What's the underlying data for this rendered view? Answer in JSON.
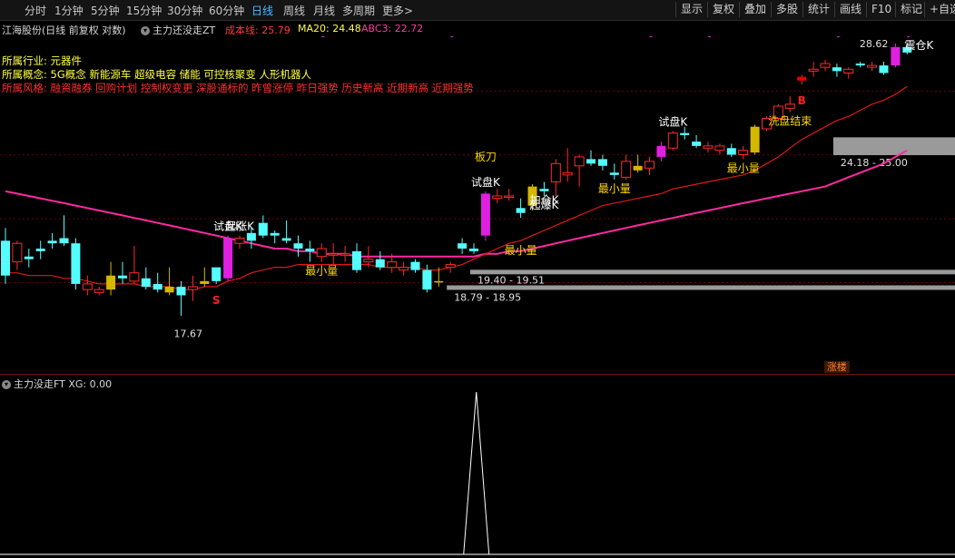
{
  "toolbar": {
    "periods": [
      "分时",
      "1分钟",
      "5分钟",
      "15分钟",
      "30分钟",
      "60分钟",
      "日线",
      "周线",
      "月线",
      "多周期",
      "更多>"
    ],
    "active_period": "日线",
    "buttons": [
      "显示",
      "复权",
      "叠加",
      "多股",
      "统计",
      "画线",
      "F10",
      "标记",
      "+自选"
    ]
  },
  "header": {
    "stock": "江海股份(日线 前复权 对数)",
    "indicator": "主力还没走ZT",
    "cost_line": "成本线: 25.79",
    "ma20": "MA20: 24.48",
    "abc3": "ABC3: 22.72"
  },
  "info": {
    "industry_label": "所属行业:",
    "industry": "元器件",
    "concept_label": "所属概念:",
    "concepts": "5G概念 新能源车 超级电容 储能 可控核聚变 人形机器人",
    "style_label": "所属风格:",
    "styles": "融资融券 回购计划 控制权变更 深股通标的 昨曾涨停 昨日强势 历史新高 近期新高 近期强势"
  },
  "sub_panel": {
    "title": "主力没走FT XG: 0.00"
  },
  "colors": {
    "up": "#ff2a2a",
    "down": "#54ffff",
    "magenta_bar": "#e020e0",
    "gold_bar": "#d4b800",
    "ma_pink": "#ff2aa0",
    "cost_red": "#e01818",
    "grid": "#6a0000"
  },
  "chart_data": {
    "type": "candlestick",
    "scale": "log",
    "price_min": 16.5,
    "price_max": 30.0,
    "candles": [
      {
        "o": 20.6,
        "h": 21.1,
        "l": 19.0,
        "c": 19.3,
        "s": "d"
      },
      {
        "o": 19.8,
        "h": 20.6,
        "l": 19.5,
        "c": 20.5,
        "s": "u"
      },
      {
        "o": 19.9,
        "h": 20.3,
        "l": 19.6,
        "c": 20.0,
        "s": "d"
      },
      {
        "o": 20.2,
        "h": 20.6,
        "l": 19.9,
        "c": 20.3,
        "s": "d"
      },
      {
        "o": 20.6,
        "h": 20.9,
        "l": 20.3,
        "c": 20.5,
        "s": "d"
      },
      {
        "o": 20.7,
        "h": 21.6,
        "l": 20.4,
        "c": 20.5,
        "s": "d"
      },
      {
        "o": 20.5,
        "h": 20.7,
        "l": 18.8,
        "c": 19.0,
        "s": "d"
      },
      {
        "o": 19.0,
        "h": 19.3,
        "l": 18.6,
        "c": 18.8,
        "s": "u"
      },
      {
        "o": 18.8,
        "h": 18.9,
        "l": 18.6,
        "c": 18.7,
        "s": "u"
      },
      {
        "o": 18.8,
        "h": 19.8,
        "l": 18.6,
        "c": 19.3,
        "s": "g"
      },
      {
        "o": 19.3,
        "h": 19.8,
        "l": 19.0,
        "c": 19.2,
        "s": "d"
      },
      {
        "o": 19.4,
        "h": 20.4,
        "l": 19.0,
        "c": 19.1,
        "s": "u"
      },
      {
        "o": 19.2,
        "h": 19.6,
        "l": 18.8,
        "c": 18.9,
        "s": "d"
      },
      {
        "o": 19.0,
        "h": 19.4,
        "l": 18.7,
        "c": 18.8,
        "s": "d"
      },
      {
        "o": 18.9,
        "h": 19.6,
        "l": 18.6,
        "c": 18.7,
        "s": "g"
      },
      {
        "o": 18.9,
        "h": 19.1,
        "l": 17.9,
        "c": 18.6,
        "s": "d"
      },
      {
        "o": 18.8,
        "h": 19.3,
        "l": 18.4,
        "c": 18.9,
        "s": "u"
      },
      {
        "o": 19.1,
        "h": 19.6,
        "l": 18.9,
        "c": 19.0,
        "s": "g"
      },
      {
        "o": 19.1,
        "h": 19.6,
        "l": 19.0,
        "c": 19.6,
        "s": "d"
      },
      {
        "o": 19.2,
        "h": 20.8,
        "l": 19.1,
        "c": 20.7,
        "s": "m"
      },
      {
        "o": 20.5,
        "h": 20.8,
        "l": 20.3,
        "c": 20.7,
        "s": "u"
      },
      {
        "o": 20.6,
        "h": 21.1,
        "l": 20.3,
        "c": 20.9,
        "s": "d"
      },
      {
        "o": 21.3,
        "h": 21.6,
        "l": 20.7,
        "c": 20.8,
        "s": "d"
      },
      {
        "o": 20.8,
        "h": 21.0,
        "l": 20.5,
        "c": 20.9,
        "s": "d"
      },
      {
        "o": 20.7,
        "h": 21.4,
        "l": 20.5,
        "c": 20.6,
        "s": "d"
      },
      {
        "o": 20.5,
        "h": 20.8,
        "l": 20.0,
        "c": 20.3,
        "s": "d"
      },
      {
        "o": 20.3,
        "h": 20.6,
        "l": 19.8,
        "c": 20.2,
        "s": "d"
      },
      {
        "o": 20.3,
        "h": 20.5,
        "l": 19.8,
        "c": 20.0,
        "s": "u"
      },
      {
        "o": 20.1,
        "h": 20.5,
        "l": 19.7,
        "c": 20.1,
        "s": "u"
      },
      {
        "o": 20.1,
        "h": 20.4,
        "l": 19.8,
        "c": 20.1,
        "s": "u"
      },
      {
        "o": 20.2,
        "h": 20.5,
        "l": 19.4,
        "c": 19.5,
        "s": "d"
      },
      {
        "o": 19.8,
        "h": 20.4,
        "l": 19.6,
        "c": 19.9,
        "s": "u"
      },
      {
        "o": 19.9,
        "h": 20.2,
        "l": 19.5,
        "c": 19.6,
        "s": "d"
      },
      {
        "o": 19.6,
        "h": 20.1,
        "l": 19.4,
        "c": 19.8,
        "s": "u"
      },
      {
        "o": 19.6,
        "h": 19.8,
        "l": 19.3,
        "c": 19.5,
        "s": "u"
      },
      {
        "o": 19.8,
        "h": 19.9,
        "l": 19.4,
        "c": 19.5,
        "s": "d"
      },
      {
        "o": 19.5,
        "h": 19.7,
        "l": 18.7,
        "c": 18.8,
        "s": "d"
      },
      {
        "o": 19.1,
        "h": 19.6,
        "l": 18.9,
        "c": 19.1,
        "s": "g"
      },
      {
        "o": 19.6,
        "h": 19.8,
        "l": 19.4,
        "c": 19.7,
        "s": "u"
      },
      {
        "o": 20.3,
        "h": 20.7,
        "l": 20.1,
        "c": 20.5,
        "s": "d"
      },
      {
        "o": 20.3,
        "h": 20.5,
        "l": 20.1,
        "c": 20.2,
        "s": "d"
      },
      {
        "o": 20.8,
        "h": 22.6,
        "l": 20.6,
        "c": 22.5,
        "s": "m"
      },
      {
        "o": 22.4,
        "h": 22.7,
        "l": 22.1,
        "c": 22.3,
        "s": "u"
      },
      {
        "o": 22.4,
        "h": 22.7,
        "l": 22.2,
        "c": 22.4,
        "s": "u"
      },
      {
        "o": 21.7,
        "h": 22.3,
        "l": 21.5,
        "c": 21.9,
        "s": "d"
      },
      {
        "o": 22.0,
        "h": 22.9,
        "l": 21.8,
        "c": 22.8,
        "s": "g"
      },
      {
        "o": 22.6,
        "h": 23.0,
        "l": 22.4,
        "c": 22.7,
        "s": "d"
      },
      {
        "o": 23.0,
        "h": 24.0,
        "l": 22.4,
        "c": 23.8,
        "s": "u"
      },
      {
        "o": 23.4,
        "h": 24.5,
        "l": 23.0,
        "c": 23.3,
        "s": "u"
      },
      {
        "o": 23.7,
        "h": 24.2,
        "l": 22.8,
        "c": 24.1,
        "s": "u"
      },
      {
        "o": 24.0,
        "h": 24.4,
        "l": 23.7,
        "c": 23.8,
        "s": "d"
      },
      {
        "o": 24.0,
        "h": 24.2,
        "l": 23.5,
        "c": 23.7,
        "s": "d"
      },
      {
        "o": 23.4,
        "h": 23.8,
        "l": 23.1,
        "c": 23.3,
        "s": "d"
      },
      {
        "o": 23.2,
        "h": 24.2,
        "l": 23.1,
        "c": 23.9,
        "s": "u"
      },
      {
        "o": 23.7,
        "h": 24.2,
        "l": 23.4,
        "c": 23.5,
        "s": "g"
      },
      {
        "o": 23.6,
        "h": 24.1,
        "l": 23.3,
        "c": 23.9,
        "s": "u"
      },
      {
        "o": 24.1,
        "h": 24.8,
        "l": 23.9,
        "c": 24.6,
        "s": "m"
      },
      {
        "o": 24.5,
        "h": 25.3,
        "l": 24.4,
        "c": 25.2,
        "s": "u"
      },
      {
        "o": 25.2,
        "h": 25.5,
        "l": 24.9,
        "c": 25.1,
        "s": "d"
      },
      {
        "o": 24.8,
        "h": 25.1,
        "l": 24.5,
        "c": 24.6,
        "s": "d"
      },
      {
        "o": 24.6,
        "h": 24.8,
        "l": 24.3,
        "c": 24.5,
        "s": "u"
      },
      {
        "o": 24.6,
        "h": 24.7,
        "l": 24.2,
        "c": 24.4,
        "s": "u"
      },
      {
        "o": 24.5,
        "h": 24.7,
        "l": 24.1,
        "c": 24.2,
        "s": "d"
      },
      {
        "o": 24.2,
        "h": 24.6,
        "l": 24.0,
        "c": 24.4,
        "s": "u"
      },
      {
        "o": 24.3,
        "h": 25.6,
        "l": 24.2,
        "c": 25.5,
        "s": "g"
      },
      {
        "o": 25.4,
        "h": 26.0,
        "l": 25.3,
        "c": 25.9,
        "s": "u"
      },
      {
        "o": 25.9,
        "h": 26.6,
        "l": 25.8,
        "c": 26.5,
        "s": "u"
      },
      {
        "o": 26.6,
        "h": 27.0,
        "l": 26.2,
        "c": 26.4,
        "s": "u"
      },
      {
        "o": 27.8,
        "h": 28.1,
        "l": 27.6,
        "c": 28.0,
        "s": "r"
      },
      {
        "o": 28.3,
        "h": 28.8,
        "l": 28.0,
        "c": 28.4,
        "s": "u"
      },
      {
        "o": 28.5,
        "h": 28.9,
        "l": 28.3,
        "c": 28.7,
        "s": "u"
      },
      {
        "o": 28.3,
        "h": 28.7,
        "l": 28.0,
        "c": 28.5,
        "s": "d"
      },
      {
        "o": 28.2,
        "h": 28.5,
        "l": 27.9,
        "c": 28.4,
        "s": "u"
      },
      {
        "o": 28.7,
        "h": 28.8,
        "l": 28.5,
        "c": 28.6,
        "s": "d"
      },
      {
        "o": 28.5,
        "h": 28.8,
        "l": 28.3,
        "c": 28.6,
        "s": "u"
      },
      {
        "o": 28.2,
        "h": 28.8,
        "l": 28.1,
        "c": 28.6,
        "s": "d"
      },
      {
        "o": 28.6,
        "h": 29.8,
        "l": 28.5,
        "c": 29.6,
        "s": "m"
      },
      {
        "o": 29.3,
        "h": 29.8,
        "l": 29.2,
        "c": 29.6,
        "s": "d"
      }
    ],
    "cost_line": [
      19.4,
      19.4,
      19.3,
      19.3,
      19.3,
      19.2,
      19.2,
      19.1,
      19.0,
      19.0,
      19.0,
      19.0,
      18.9,
      18.9,
      18.9,
      18.8,
      18.8,
      18.9,
      18.9,
      19.1,
      19.2,
      19.4,
      19.5,
      19.6,
      19.6,
      19.7,
      19.7,
      19.7,
      19.7,
      19.7,
      19.7,
      19.7,
      19.6,
      19.6,
      19.6,
      19.6,
      19.5,
      19.5,
      19.6,
      19.7,
      19.9,
      20.1,
      20.3,
      20.5,
      20.6,
      20.8,
      21.0,
      21.2,
      21.4,
      21.6,
      21.8,
      22.0,
      22.1,
      22.2,
      22.3,
      22.4,
      22.5,
      22.7,
      22.8,
      22.9,
      23.0,
      23.1,
      23.2,
      23.3,
      23.5,
      23.8,
      24.1,
      24.5,
      24.9,
      25.2,
      25.5,
      25.8,
      26.0,
      26.3,
      26.6,
      26.8,
      27.1,
      27.5
    ],
    "ma_line": [
      22.6,
      22.5,
      22.4,
      22.3,
      22.2,
      22.1,
      22.0,
      21.9,
      21.8,
      21.7,
      21.6,
      21.5,
      21.4,
      21.3,
      21.2,
      21.1,
      21.0,
      20.9,
      20.8,
      20.7,
      20.6,
      20.5,
      20.4,
      20.3,
      20.3,
      20.2,
      20.2,
      20.1,
      20.1,
      20.1,
      20.0,
      20.0,
      20.0,
      20.0,
      20.0,
      20.0,
      20.0,
      20.0,
      20.0,
      20.0,
      20.0,
      20.1,
      20.1,
      20.2,
      20.2,
      20.3,
      20.4,
      20.5,
      20.6,
      20.7,
      20.8,
      20.9,
      21.0,
      21.1,
      21.2,
      21.3,
      21.4,
      21.5,
      21.6,
      21.7,
      21.8,
      21.9,
      22.0,
      22.1,
      22.2,
      22.3,
      22.4,
      22.5,
      22.6,
      22.7,
      22.8,
      23.0,
      23.2,
      23.4,
      23.6,
      23.8,
      24.1,
      24.4
    ],
    "labels": [
      {
        "i": 19,
        "text": "试盘K",
        "color": "#ffffff",
        "pos": "above"
      },
      {
        "i": 20,
        "text": "起涨K",
        "color": "#ffffff",
        "pos": "above"
      },
      {
        "i": 27,
        "text": "最小量",
        "color": "#ffd800",
        "pos": "below"
      },
      {
        "i": 41,
        "text": "试盘K",
        "color": "#ffffff",
        "pos": "above"
      },
      {
        "i": 41,
        "text": "板刀",
        "color": "#ffd800",
        "pos": "top"
      },
      {
        "i": 44,
        "text": "加仓K",
        "color": "#ffffff",
        "pos": "right"
      },
      {
        "i": 46,
        "text": "起爆K",
        "color": "#ffffff",
        "pos": "below"
      },
      {
        "i": 44,
        "text": "最小量",
        "color": "#ffd800",
        "pos": "below2"
      },
      {
        "i": 52,
        "text": "最小量",
        "color": "#ffd800",
        "pos": "below"
      },
      {
        "i": 57,
        "text": "试盘K",
        "color": "#ffffff",
        "pos": "above"
      },
      {
        "i": 63,
        "text": "最小量",
        "color": "#ffd800",
        "pos": "below"
      },
      {
        "i": 67,
        "text": "洗盘结束",
        "color": "#ffd800",
        "pos": "below"
      },
      {
        "i": 76,
        "text": "震仓K",
        "color": "#ffffff",
        "pos": "right"
      }
    ],
    "price_notes": [
      {
        "i": 15,
        "text": "17.67",
        "price": 17.67
      },
      {
        "i": 76,
        "text": "28.62",
        "price": 29.8
      }
    ],
    "zones": [
      {
        "text": "24.18 - 25.00",
        "low": 24.18,
        "high": 25.0,
        "from": 71
      },
      {
        "text": "19.40 - 19.51",
        "low": 19.4,
        "high": 19.51,
        "from": 40
      },
      {
        "text": "18.79 - 18.95",
        "low": 18.79,
        "high": 18.95,
        "from": 38
      }
    ],
    "markers": [
      {
        "i": 18,
        "text": "S",
        "color": "#ff2020"
      },
      {
        "i": 68,
        "text": "B",
        "color": "#ff2020"
      }
    ],
    "tag": {
      "i": 71,
      "text": "涨楼"
    },
    "sub_series": {
      "name": "XG",
      "x_peak_index": 43,
      "peak": 1.0
    }
  }
}
